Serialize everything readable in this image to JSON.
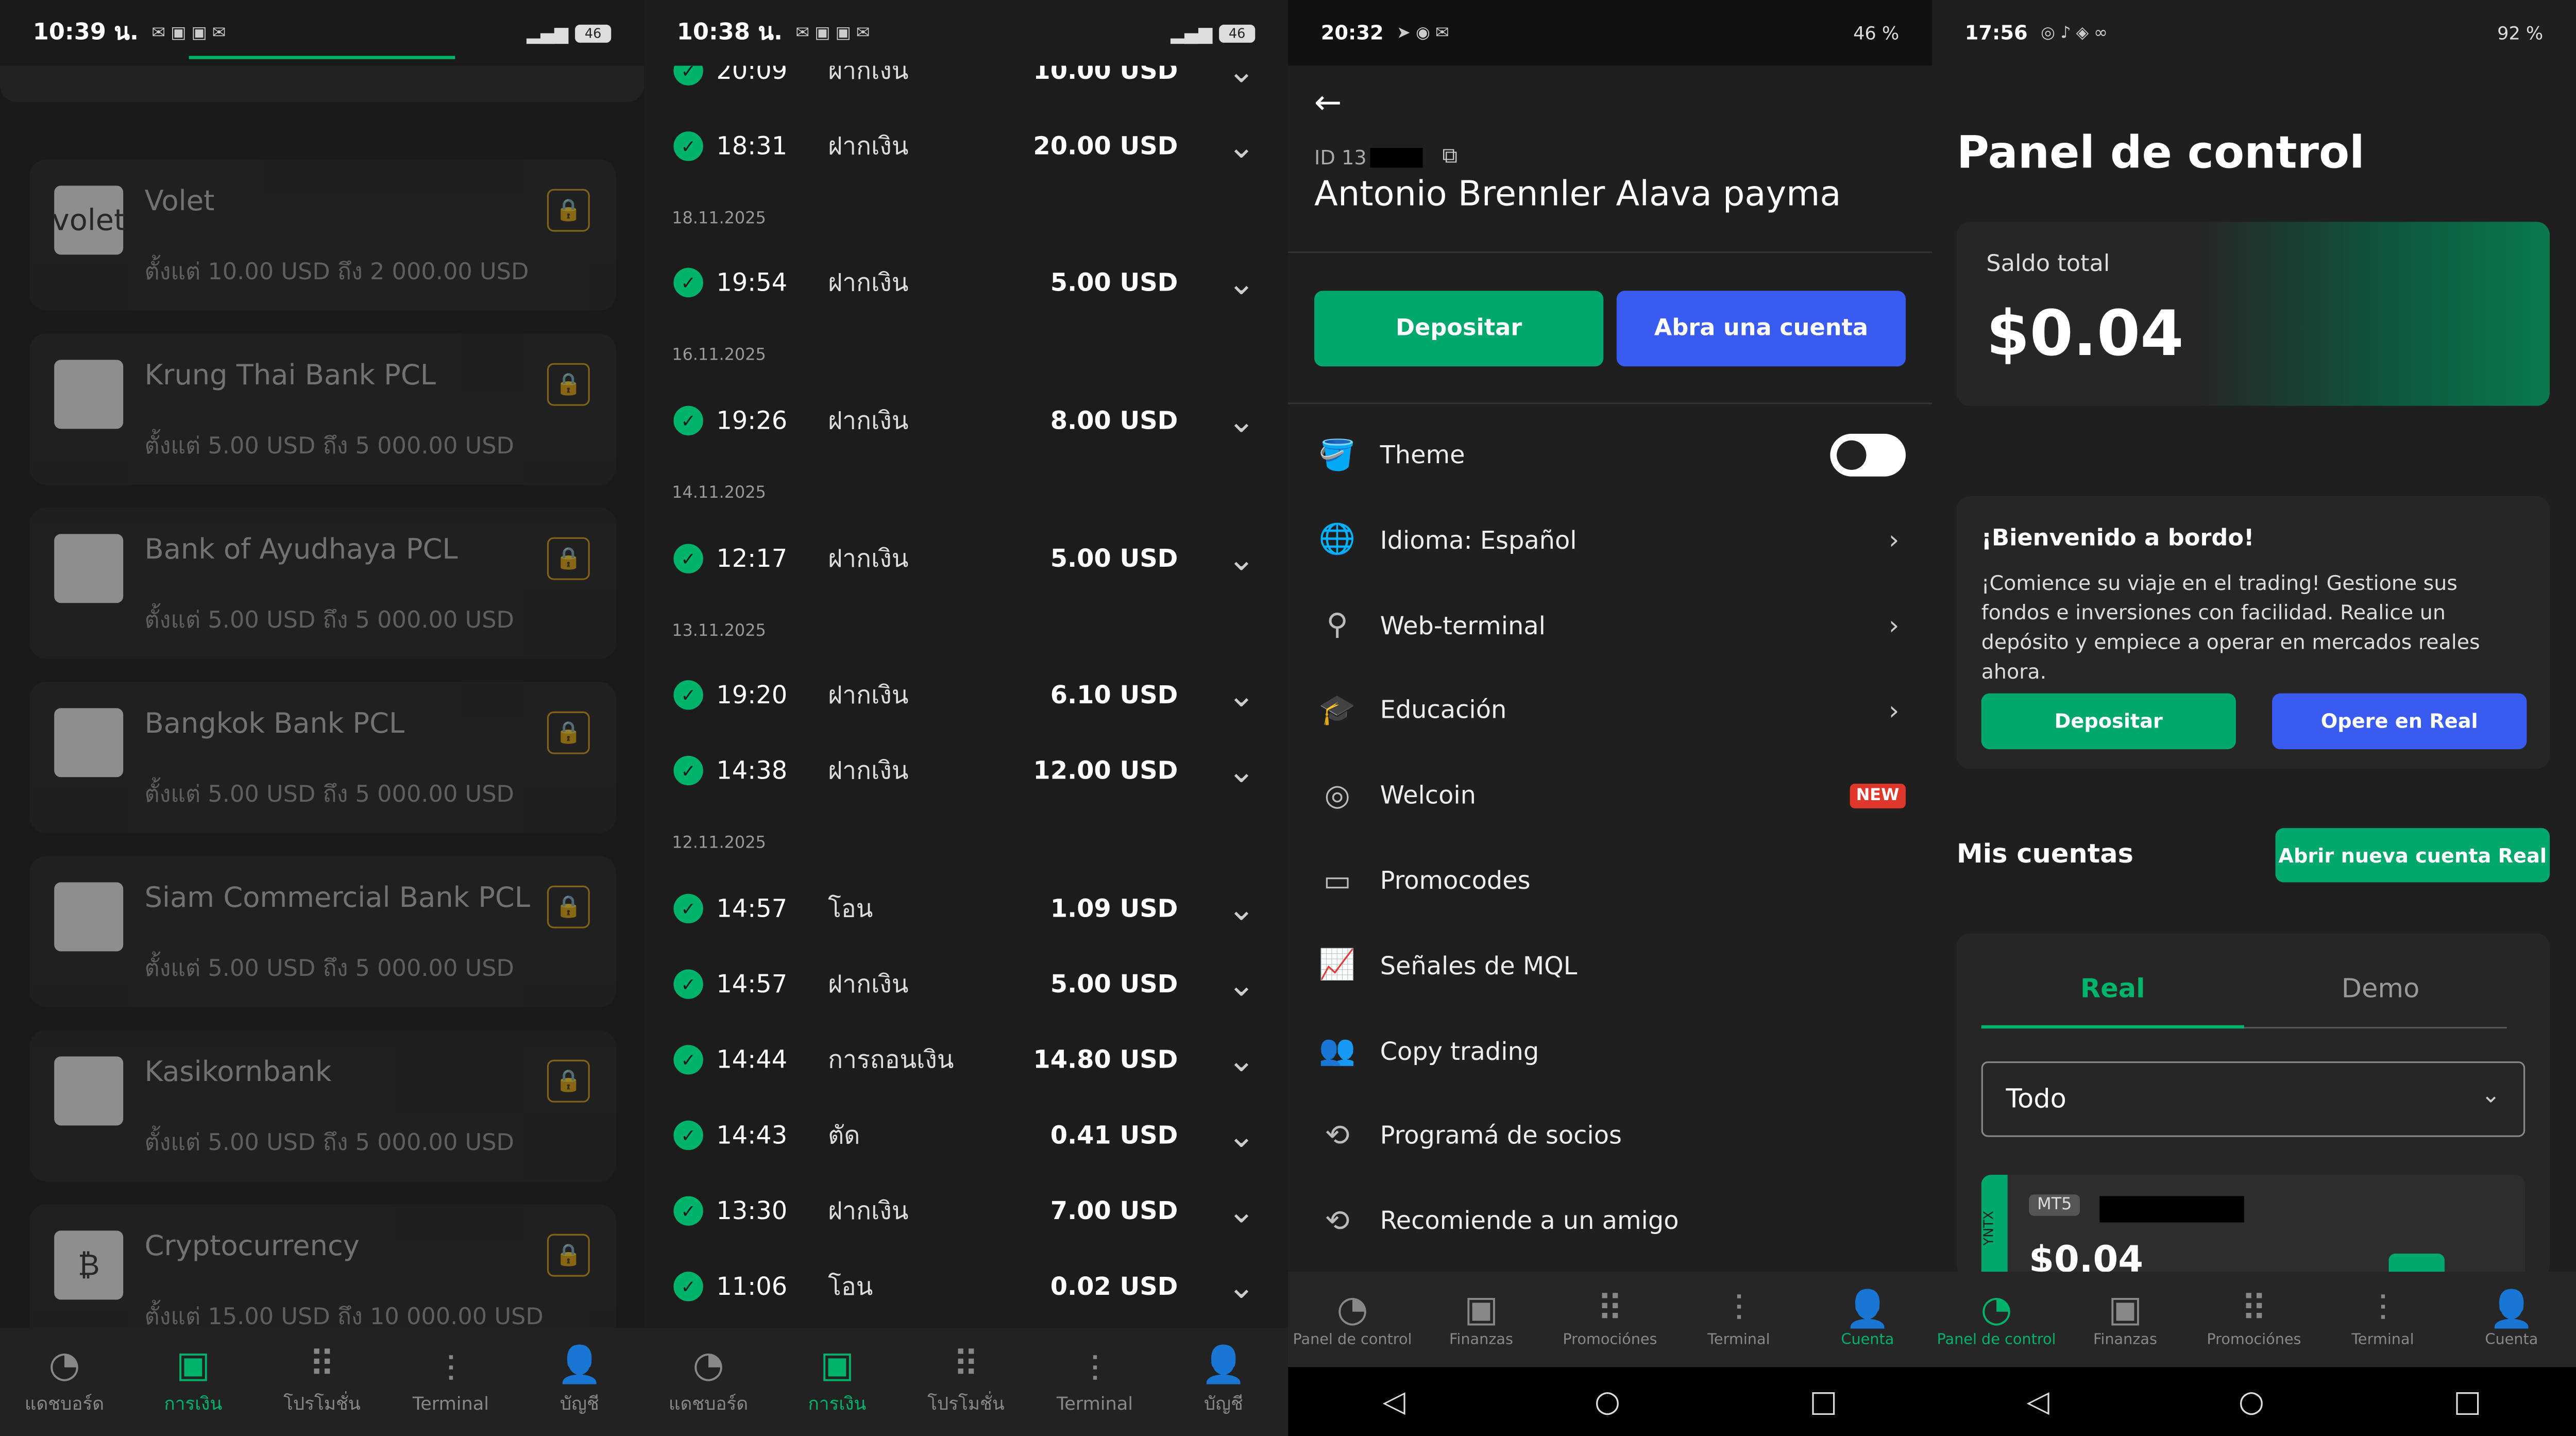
{
  "p1": {
    "time": "10:39 น.",
    "battery": "46",
    "methods": [
      {
        "name": "Volet",
        "range": "ตั้งแต่ 10.00 USD ถึง 2 000.00 USD",
        "logo": "volet"
      },
      {
        "name": "Krung Thai Bank PCL",
        "range": "ตั้งแต่ 5.00 USD ถึง 5 000.00 USD",
        "logo": ""
      },
      {
        "name": "Bank of Ayudhaya PCL",
        "range": "ตั้งแต่ 5.00 USD ถึง 5 000.00 USD",
        "logo": ""
      },
      {
        "name": "Bangkok Bank PCL",
        "range": "ตั้งแต่ 5.00 USD ถึง 5 000.00 USD",
        "logo": ""
      },
      {
        "name": "Siam Commercial Bank PCL",
        "range": "ตั้งแต่ 5.00 USD ถึง 5 000.00 USD",
        "logo": ""
      },
      {
        "name": "Kasikornbank",
        "range": "ตั้งแต่ 5.00 USD ถึง 5 000.00 USD",
        "logo": ""
      },
      {
        "name": "Cryptocurrency",
        "range": "ตั้งแต่ 15.00 USD ถึง 10 000.00 USD",
        "logo": "₿"
      }
    ],
    "nav": [
      "แดชบอร์ด",
      "การเงิน",
      "โปรโมชั่น",
      "Terminal",
      "บัญชี"
    ]
  },
  "p2": {
    "time": "10:38 น.",
    "battery": "46",
    "rows": [
      {
        "time": "20:09",
        "type": "ฝากเงิน",
        "amount": "10.00 USD"
      },
      {
        "time": "18:31",
        "type": "ฝากเงิน",
        "amount": "20.00 USD"
      },
      {
        "date": "18.11.2025"
      },
      {
        "time": "19:54",
        "type": "ฝากเงิน",
        "amount": "5.00 USD"
      },
      {
        "date": "16.11.2025"
      },
      {
        "time": "19:26",
        "type": "ฝากเงิน",
        "amount": "8.00 USD"
      },
      {
        "date": "14.11.2025"
      },
      {
        "time": "12:17",
        "type": "ฝากเงิน",
        "amount": "5.00 USD"
      },
      {
        "date": "13.11.2025"
      },
      {
        "time": "19:20",
        "type": "ฝากเงิน",
        "amount": "6.10 USD"
      },
      {
        "time": "14:38",
        "type": "ฝากเงิน",
        "amount": "12.00 USD"
      },
      {
        "date": "12.11.2025"
      },
      {
        "time": "14:57",
        "type": "โอน",
        "amount": "1.09 USD"
      },
      {
        "time": "14:57",
        "type": "ฝากเงิน",
        "amount": "5.00 USD"
      },
      {
        "time": "14:44",
        "type": "การถอนเงิน",
        "amount": "14.80 USD"
      },
      {
        "time": "14:43",
        "type": "ตัด",
        "amount": "0.41 USD"
      },
      {
        "time": "13:30",
        "type": "ฝากเงิน",
        "amount": "7.00 USD"
      },
      {
        "time": "11:06",
        "type": "โอน",
        "amount": "0.02 USD"
      }
    ],
    "nav": [
      "แดชบอร์ด",
      "การเงิน",
      "โปรโมชั่น",
      "Terminal",
      "บัญชี"
    ]
  },
  "p3": {
    "time": "20:32",
    "battery": "46 %",
    "id_prefix": "ID 13",
    "name": "Antonio Brennler Alava payma",
    "btn_deposit": "Depositar",
    "btn_open": "Abra una cuenta",
    "menu": [
      "Theme",
      "Idioma: Español",
      "Web-terminal",
      "Educación",
      "Welcoin",
      "Promocodes",
      "Señales de MQL",
      "Copy trading",
      "Programá de socios",
      "Recomiende a un amigo"
    ],
    "new_badge": "NEW",
    "nav": [
      "Panel de control",
      "Finanzas",
      "Promociónes",
      "Terminal",
      "Cuenta"
    ]
  },
  "p4": {
    "time": "17:56",
    "battery": "92 %",
    "title": "Panel de control",
    "saldo_label": "Saldo total",
    "saldo": "$0.04",
    "welcome_title": "¡Bienvenido a bordo!",
    "welcome_text": "¡Comience su viaje en el trading! Gestione sus fondos e inversiones con facilidad. Realice un depósito y empiece a operar en mercados reales ahora.",
    "btn_deposit": "Depositar",
    "btn_real": "Opere en Real",
    "cuentas": "Mis cuentas",
    "btn_new": "Abrir nueva cuenta Real",
    "tab_real": "Real",
    "tab_demo": "Demo",
    "filter": "Todo",
    "acct_badge": "MT5",
    "acct_side": "YNTX",
    "acct_amount": "$0.04",
    "nav": [
      "Panel de control",
      "Finanzas",
      "Promociónes",
      "Terminal",
      "Cuenta"
    ]
  }
}
